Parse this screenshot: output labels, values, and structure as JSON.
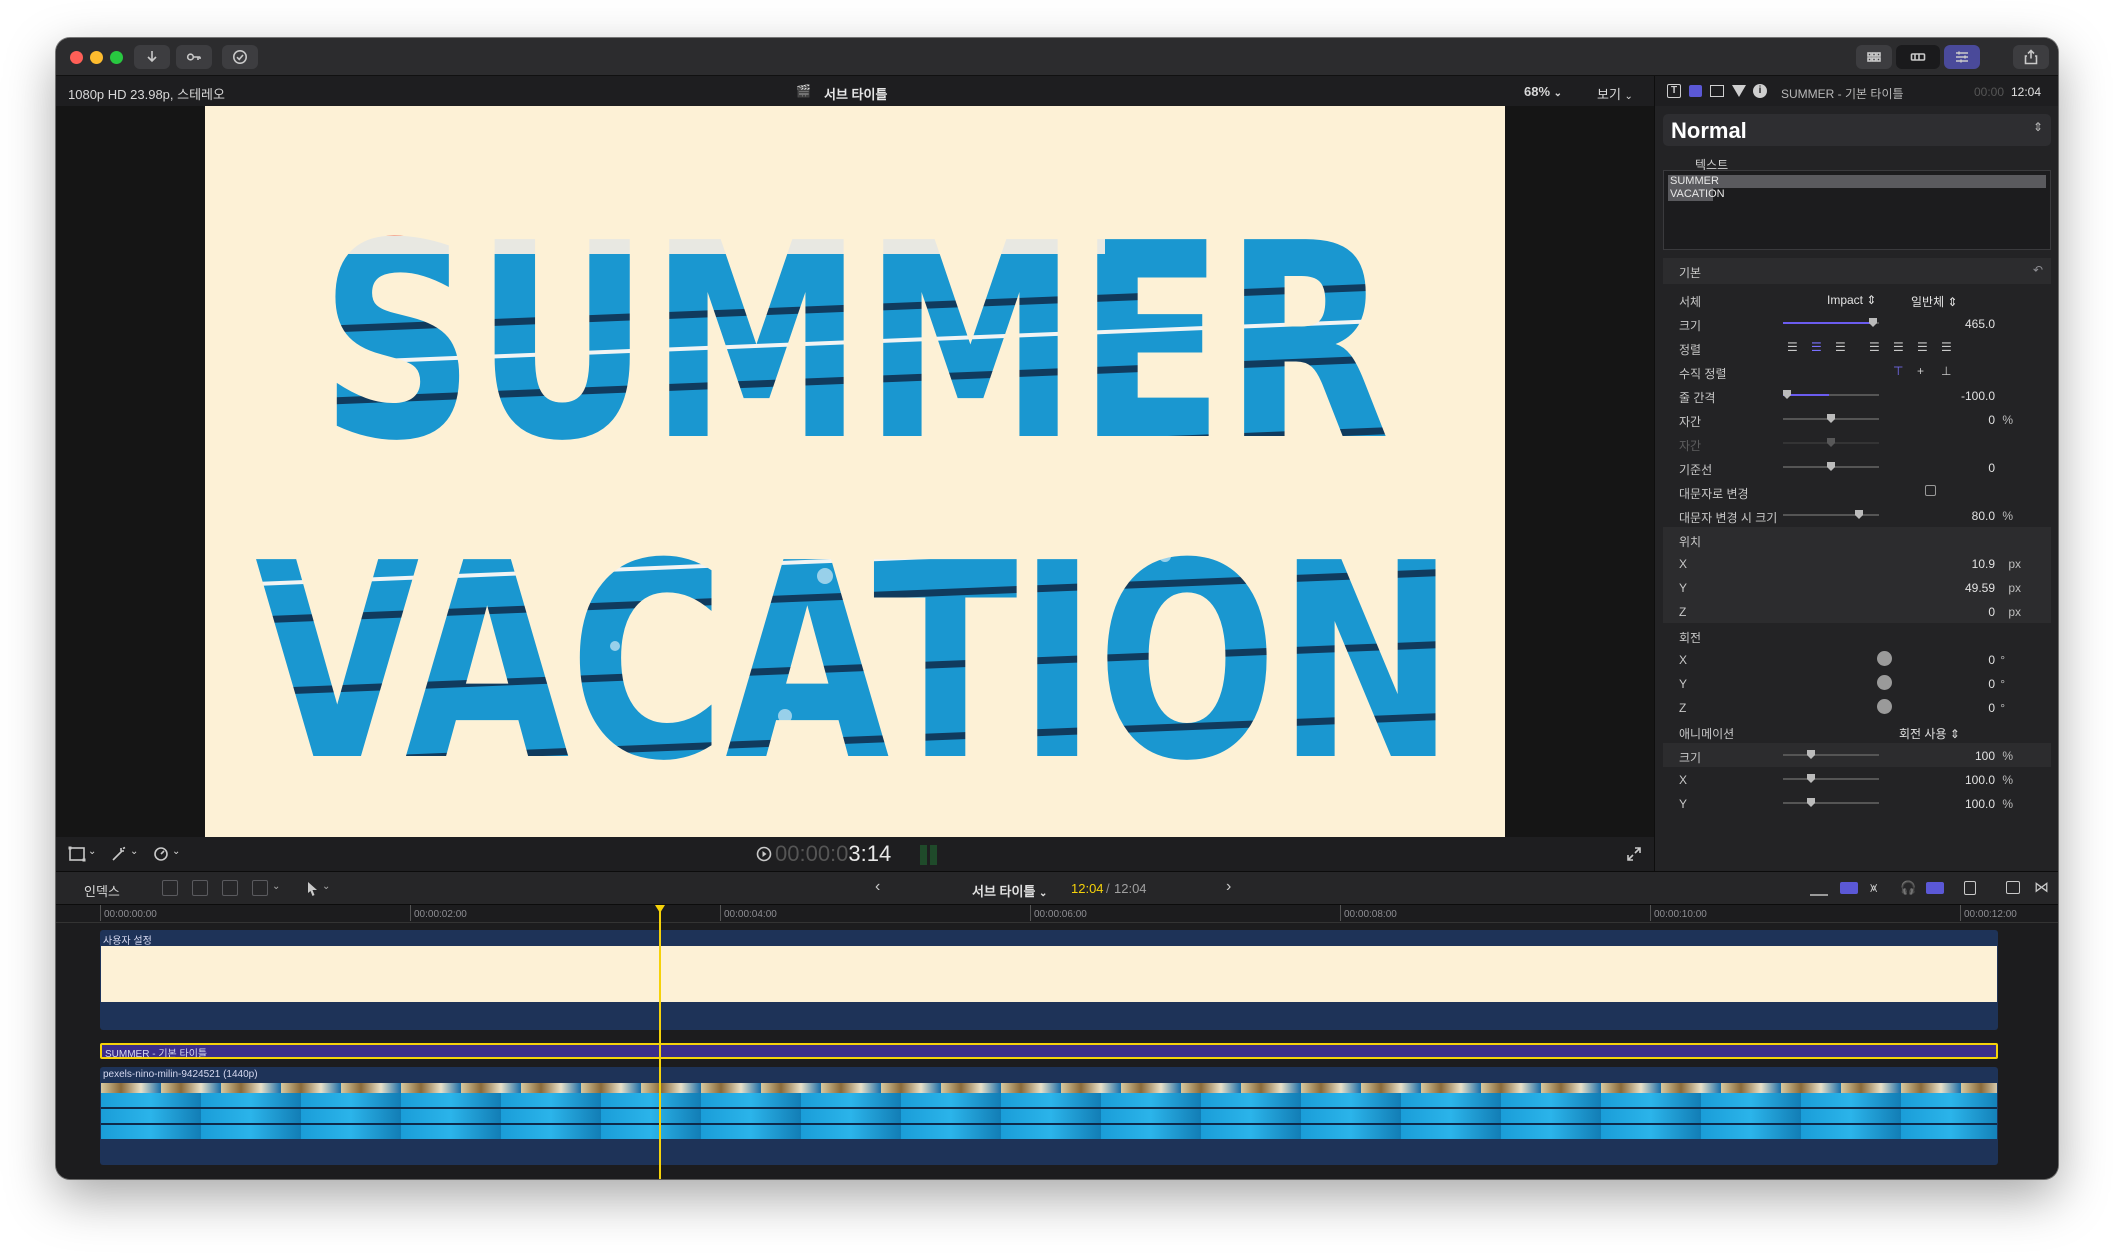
{
  "toolbar": {
    "import_icon": "download-icon",
    "keywords_icon": "key-icon",
    "background_tasks_icon": "checkmark-circle-icon",
    "share_icon": "share-icon",
    "layout_icons": [
      "browser-grid-icon",
      "timeline-icon",
      "inspector-icon"
    ]
  },
  "viewer": {
    "format": "1080p HD 23.98p, 스테레오",
    "title": "서브 타이틀",
    "zoom": "68%",
    "view_menu": "보기",
    "timecode_dim": "00:00:0",
    "timecode_main": "3:14",
    "title_line1": "SUMMER",
    "title_line2": "VACATION"
  },
  "inspector": {
    "clip_name": "SUMMER - 기본 타이틀",
    "duration_dim": "00:00",
    "duration": "12:04",
    "preset": "Normal",
    "text_section": "텍스트",
    "text_content_line1": "SUMMER",
    "text_content_line2": "VACATION",
    "basic_section": "기본",
    "rows": {
      "font_label": "서체",
      "font_value": "Impact",
      "font_style": "일반체",
      "size_label": "크기",
      "size_value": "465.0",
      "alignment_label": "정렬",
      "vertical_alignment_label": "수직 정렬",
      "line_spacing_label": "줄 간격",
      "line_spacing_value": "-100.0",
      "tracking_label": "자간",
      "tracking_value": "0",
      "tracking_unit": "%",
      "kerning_label": "자간",
      "baseline_label": "기준선",
      "baseline_value": "0",
      "all_caps_label": "대문자로 변경",
      "all_caps_size_label": "대문자 변경 시 크기",
      "all_caps_size_value": "80.0",
      "all_caps_size_unit": "%",
      "position_label": "위치",
      "pos_x_label": "X",
      "pos_x_value": "10.9",
      "pos_x_unit": "px",
      "pos_y_label": "Y",
      "pos_y_value": "49.59",
      "pos_y_unit": "px",
      "pos_z_label": "Z",
      "pos_z_value": "0",
      "pos_z_unit": "px",
      "rotation_label": "회전",
      "rot_x_label": "X",
      "rot_x_value": "0",
      "rot_x_unit": "°",
      "rot_y_label": "Y",
      "rot_y_value": "0",
      "rot_y_unit": "°",
      "rot_z_label": "Z",
      "rot_z_value": "0",
      "rot_z_unit": "°",
      "animation_label": "애니메이션",
      "animation_value": "회전 사용",
      "scale_label": "크기",
      "scale_value": "100",
      "scale_unit": "%",
      "scale_x_label": "X",
      "scale_x_value": "100.0",
      "scale_x_unit": "%",
      "scale_y_label": "Y",
      "scale_y_value": "100.0",
      "scale_y_unit": "%"
    }
  },
  "timeline": {
    "index_label": "인덱스",
    "project_name": "서브 타이틀",
    "position": "12:04",
    "total": "12:04",
    "ruler": [
      "00:00:00:00",
      "00:00:02:00",
      "00:00:04:00",
      "00:00:06:00",
      "00:00:08:00",
      "00:00:10:00",
      "00:00:12:00"
    ],
    "custom_clip_label": "사용자 설정",
    "title_clip_label": "SUMMER - 기본 타이틀",
    "video_clip_label": "pexels-nino-milin-9424521 (1440p)"
  },
  "colors": {
    "canvas_bg": "#fdf1d6",
    "pool_blue": "#1d9fd6",
    "accent_purple": "#6b5cf0",
    "playhead_yellow": "#f5d20a",
    "clip_blue": "#1e3358"
  }
}
